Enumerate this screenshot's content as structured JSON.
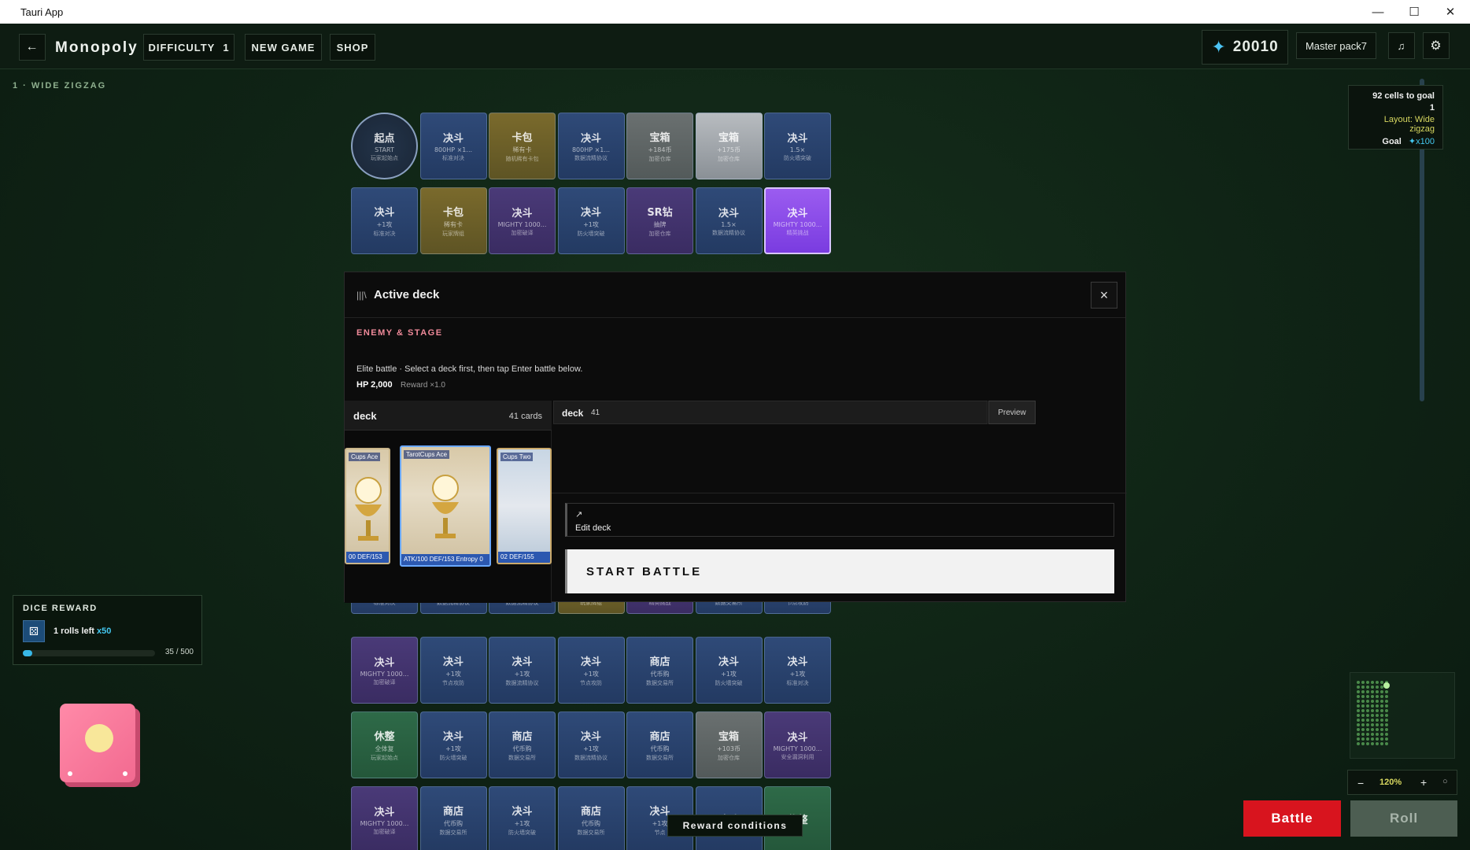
{
  "window": {
    "title": "Tauri App",
    "controls": {
      "minimize": "—",
      "maximize": "☐",
      "close": "✕"
    }
  },
  "appbar": {
    "back_icon": "←",
    "brand": "Monopoly",
    "difficulty_label": "DIFFICULTY",
    "difficulty_value": "1",
    "new_game": "NEW GAME",
    "shop": "SHOP",
    "currency_icon": "✦",
    "currency_value": "20010",
    "pack": "Master pack7",
    "music_icon": "♫",
    "settings_icon": "⚙"
  },
  "stage_label": "1 · WIDE ZIGZAG",
  "board": {
    "row1": [
      {
        "t": "起点",
        "s": "START",
        "u": "玩家起始点",
        "style": "start"
      },
      {
        "t": "决斗",
        "s": "800HP ×1...",
        "u": "标准对决",
        "style": "blue"
      },
      {
        "t": "卡包",
        "s": "稀有卡",
        "u": "随机稀有卡包",
        "style": "gold"
      },
      {
        "t": "决斗",
        "s": "800HP ×1...",
        "u": "数据流精协议",
        "style": "blue"
      },
      {
        "t": "宝箱",
        "s": "+184币",
        "u": "加密仓库",
        "style": "grey"
      },
      {
        "t": "宝箱",
        "s": "+175币",
        "u": "加密仓库",
        "style": "silver"
      },
      {
        "t": "决斗",
        "s": "1.5×",
        "u": "防火墙突破",
        "style": "blue"
      }
    ],
    "row2": [
      {
        "t": "决斗",
        "s": "+1攻",
        "u": "标准对决",
        "style": "blue"
      },
      {
        "t": "卡包",
        "s": "稀有卡",
        "u": "玩家牌组",
        "style": "gold"
      },
      {
        "t": "决斗",
        "s": "MIGHTY 1000...",
        "u": "加密破译",
        "style": "purple"
      },
      {
        "t": "决斗",
        "s": "+1攻",
        "u": "防火墙突破",
        "style": "blue"
      },
      {
        "t": "SR钻",
        "s": "抽牌",
        "u": "加密仓库",
        "style": "purple"
      },
      {
        "t": "决斗",
        "s": "1.5×",
        "u": "数据流精协议",
        "style": "blue"
      },
      {
        "t": "决斗",
        "s": "MIGHTY 1000...",
        "u": "精英挑战",
        "style": "violet"
      }
    ],
    "row7": [
      {
        "t": "决斗",
        "s": "MIGHTY 1000...",
        "u": "加密破译",
        "style": "purple"
      },
      {
        "t": "决斗",
        "s": "+1攻",
        "u": "节点攻防",
        "style": "blue"
      },
      {
        "t": "决斗",
        "s": "+1攻",
        "u": "数据流精协议",
        "style": "blue"
      },
      {
        "t": "决斗",
        "s": "+1攻",
        "u": "节点攻防",
        "style": "blue"
      },
      {
        "t": "商店",
        "s": "代币购",
        "u": "数据交易所",
        "style": "blue"
      },
      {
        "t": "决斗",
        "s": "+1攻",
        "u": "防火墙突破",
        "style": "blue"
      },
      {
        "t": "决斗",
        "s": "+1攻",
        "u": "标准对决",
        "style": "blue"
      }
    ],
    "row8": [
      {
        "t": "休整",
        "s": "全体复",
        "u": "玩家起始点",
        "style": "green"
      },
      {
        "t": "决斗",
        "s": "+1攻",
        "u": "防火墙突破",
        "style": "blue"
      },
      {
        "t": "商店",
        "s": "代币购",
        "u": "数据交易所",
        "style": "blue"
      },
      {
        "t": "决斗",
        "s": "+1攻",
        "u": "数据流精协议",
        "style": "blue"
      },
      {
        "t": "商店",
        "s": "代币购",
        "u": "数据交易所",
        "style": "blue"
      },
      {
        "t": "宝箱",
        "s": "+103币",
        "u": "加密仓库",
        "style": "grey"
      },
      {
        "t": "决斗",
        "s": "MIGHTY 1000...",
        "u": "安全漏洞利用",
        "style": "purple"
      }
    ],
    "row9": [
      {
        "t": "决斗",
        "s": "MIGHTY 1000...",
        "u": "加密破译",
        "style": "purple"
      },
      {
        "t": "商店",
        "s": "代币购",
        "u": "数据交易所",
        "style": "blue"
      },
      {
        "t": "决斗",
        "s": "+1攻",
        "u": "防火墙突破",
        "style": "blue"
      },
      {
        "t": "商店",
        "s": "代币购",
        "u": "数据交易所",
        "style": "blue"
      },
      {
        "t": "决斗",
        "s": "+1攻",
        "u": "节点",
        "style": "blue"
      },
      {
        "t": "决斗",
        "s": "",
        "u": "",
        "style": "blue"
      },
      {
        "t": "休整",
        "s": "",
        "u": "",
        "style": "green"
      }
    ],
    "row6_labels": [
      "标准对决",
      "数据流精协议",
      "数据流精协议",
      "玩家牌组",
      "精英挑战",
      "数据交易所",
      "节点攻防"
    ]
  },
  "modal": {
    "icon": "|||\\",
    "title": "Active deck",
    "close": "×",
    "enemy_tag": "ENEMY & STAGE",
    "description": "Elite battle · Select a deck first, then tap Enter battle below.",
    "hp": "HP 2,000",
    "reward": "Reward ×1.0",
    "deck_left": {
      "name": "deck",
      "count": "41 cards"
    },
    "cards": [
      {
        "label": "Cups Ace",
        "stats": "00 DEF/153"
      },
      {
        "label": "TarotCups Ace",
        "stats": "ATK/100 DEF/153  Entropy 0"
      },
      {
        "label": "Cups Two",
        "stats": "02 DEF/155"
      }
    ],
    "deck_right": {
      "name": "deck",
      "count": "41"
    },
    "preview": "Preview",
    "edit_icon": "↗",
    "edit_deck": "Edit deck",
    "start_battle": "START BATTLE"
  },
  "dice_reward": {
    "title": "DICE REWARD",
    "icon": "⚄",
    "rolls_left": "1 rolls left",
    "multiplier": "x50",
    "progress_text": "35 / 500",
    "progress": 0.07
  },
  "goal_panel": {
    "cells_to_goal": "92 cells to goal",
    "value": "1",
    "layout": "Layout: Wide zigzag",
    "goal_label": "Goal",
    "goal_value": "✦x100"
  },
  "zoom": {
    "minus": "−",
    "value": "120%",
    "plus": "+",
    "reset": "○"
  },
  "actions": {
    "battle": "Battle",
    "roll": "Roll",
    "reward_conditions": "Reward conditions"
  },
  "colors": {
    "accent_red": "#d8141e",
    "accent_cyan": "#44c8f0",
    "goal_yellow": "#d8d860"
  }
}
